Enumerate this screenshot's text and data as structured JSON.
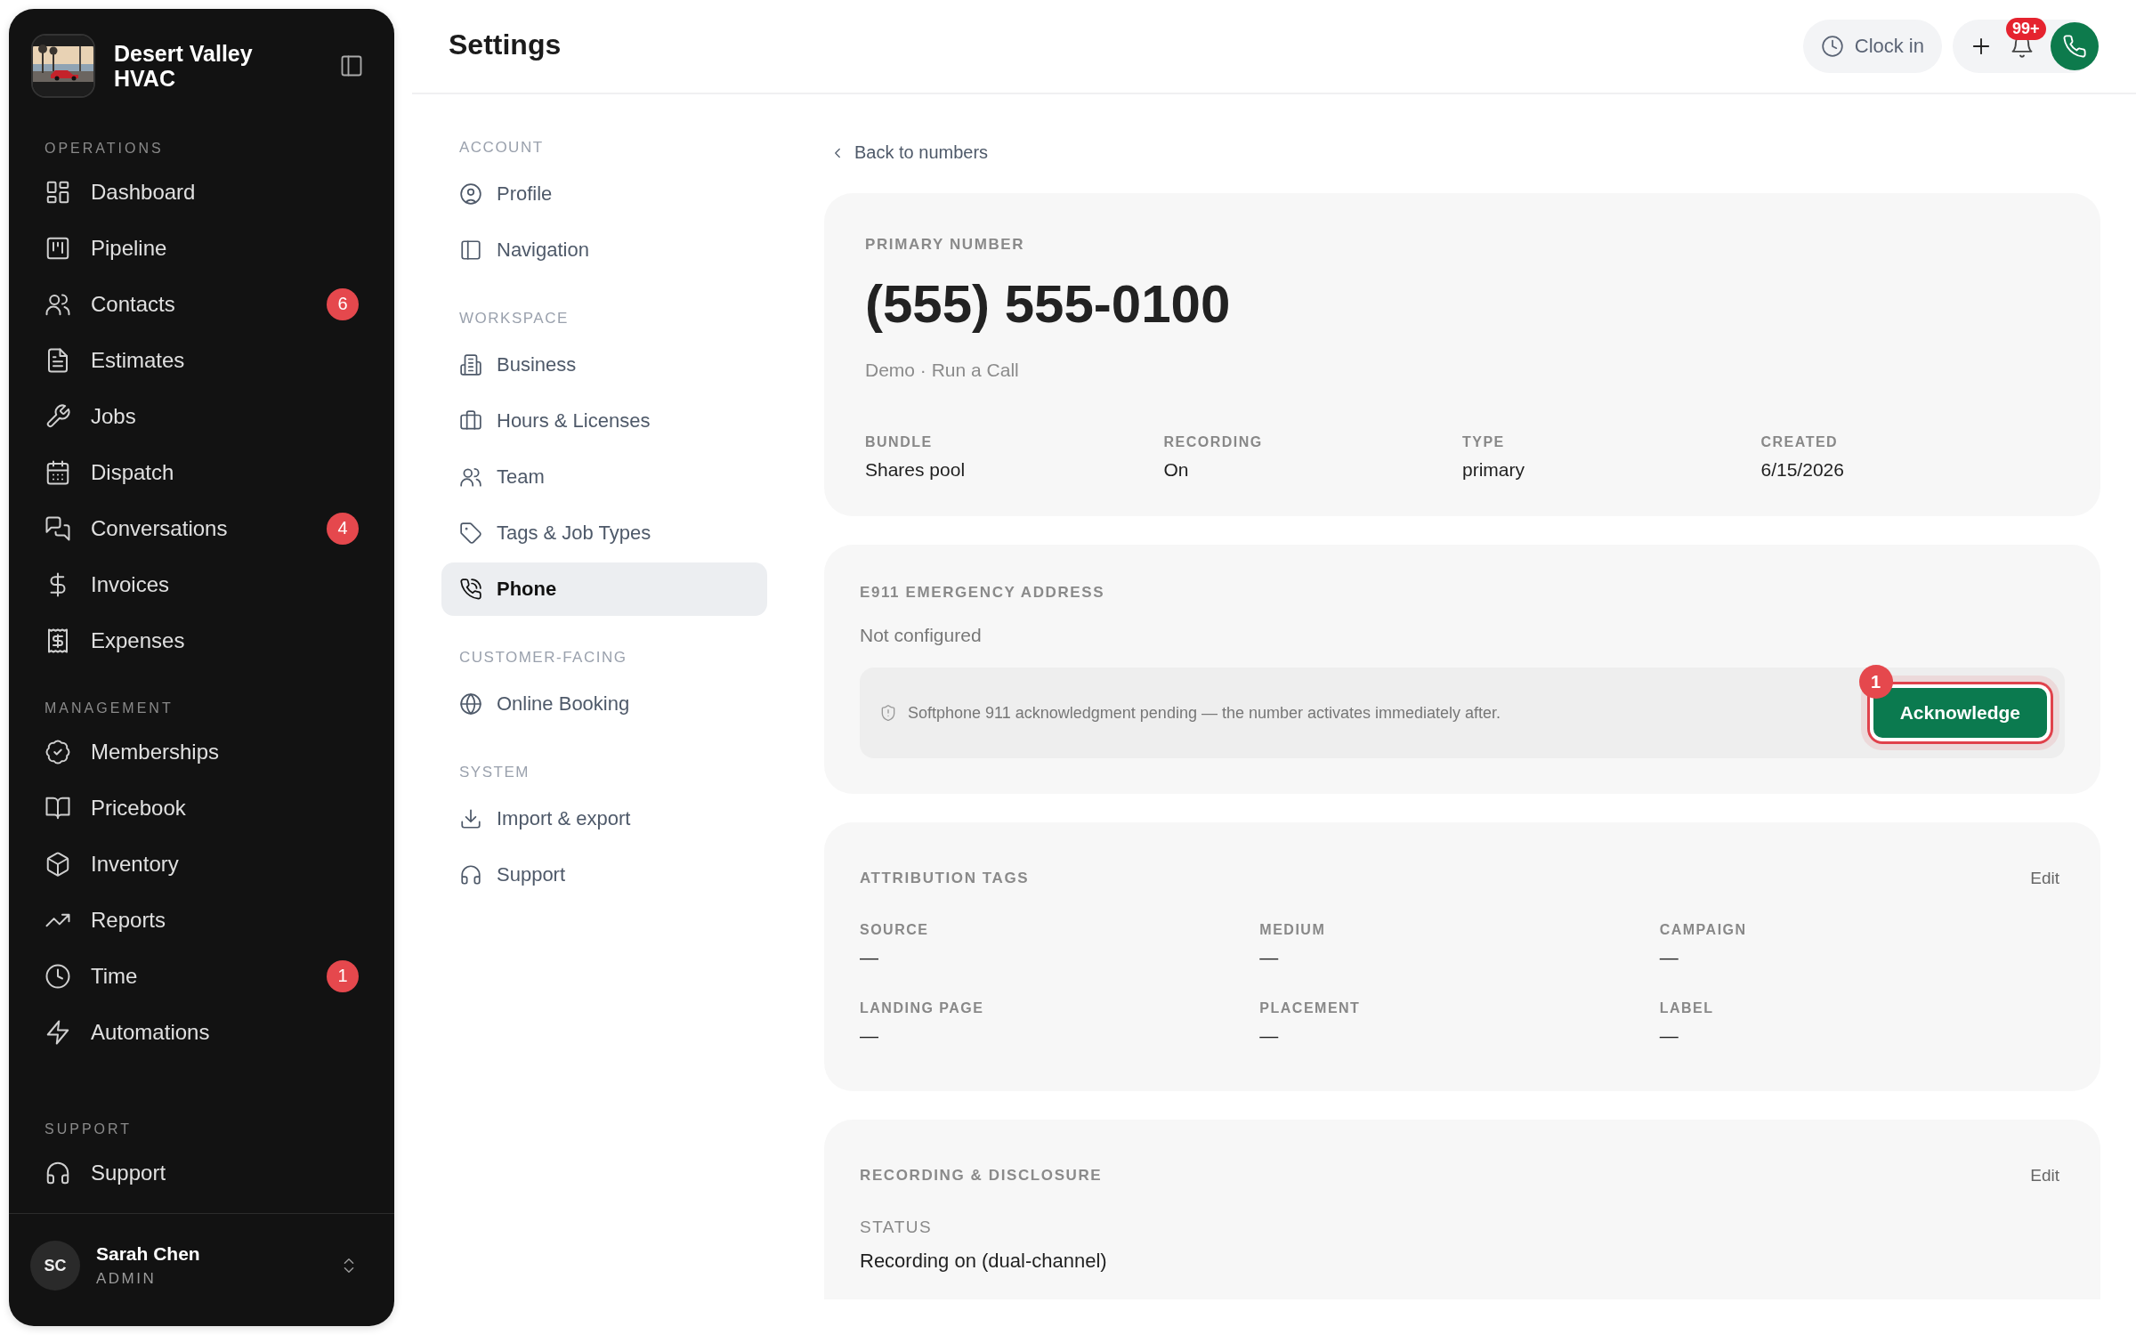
{
  "brand": {
    "name": "Desert Valley HVAC"
  },
  "sidebar": {
    "sections": [
      {
        "label": "OPERATIONS",
        "items": [
          {
            "label": "Dashboard",
            "selected": false
          },
          {
            "label": "Pipeline",
            "selected": false
          },
          {
            "label": "Contacts",
            "badge": "6",
            "selected": false
          },
          {
            "label": "Estimates",
            "selected": false
          },
          {
            "label": "Jobs",
            "selected": false
          },
          {
            "label": "Dispatch",
            "selected": false
          },
          {
            "label": "Conversations",
            "badge": "4",
            "selected": false
          },
          {
            "label": "Invoices",
            "selected": false
          },
          {
            "label": "Expenses",
            "selected": false
          }
        ]
      },
      {
        "label": "MANAGEMENT",
        "items": [
          {
            "label": "Memberships",
            "selected": false
          },
          {
            "label": "Pricebook",
            "selected": false
          },
          {
            "label": "Inventory",
            "selected": false
          },
          {
            "label": "Reports",
            "selected": false
          },
          {
            "label": "Time",
            "badge": "1",
            "selected": false
          },
          {
            "label": "Automations",
            "selected": false
          }
        ]
      }
    ],
    "support": {
      "label": "SUPPORT",
      "items": [
        {
          "label": "Support",
          "selected": false
        }
      ]
    }
  },
  "user": {
    "initials": "SC",
    "name": "Sarah Chen",
    "role": "ADMIN"
  },
  "page_title": "Settings",
  "header": {
    "clock_in": "Clock in",
    "notifications_badge": "99+"
  },
  "settings_nav": {
    "sections": [
      {
        "label": "ACCOUNT",
        "items": [
          {
            "label": "Profile",
            "selected": false
          },
          {
            "label": "Navigation",
            "selected": false
          }
        ]
      },
      {
        "label": "WORKSPACE",
        "items": [
          {
            "label": "Business",
            "selected": false
          },
          {
            "label": "Hours & Licenses",
            "selected": false
          },
          {
            "label": "Team",
            "selected": false
          },
          {
            "label": "Tags & Job Types",
            "selected": false
          },
          {
            "label": "Phone",
            "selected": true
          }
        ]
      },
      {
        "label": "CUSTOMER-FACING",
        "items": [
          {
            "label": "Online Booking",
            "selected": false
          }
        ]
      },
      {
        "label": "SYSTEM",
        "items": [
          {
            "label": "Import & export",
            "selected": false
          },
          {
            "label": "Support",
            "selected": false
          }
        ]
      }
    ]
  },
  "back_link": "Back to numbers",
  "primary_card": {
    "label": "PRIMARY NUMBER",
    "number": "(555) 555-0100",
    "subtitle": "Demo · Run a Call",
    "fields": [
      {
        "label": "BUNDLE",
        "value": "Shares pool"
      },
      {
        "label": "RECORDING",
        "value": "On"
      },
      {
        "label": "TYPE",
        "value": "primary"
      },
      {
        "label": "CREATED",
        "value": "6/15/2026"
      }
    ]
  },
  "e911_card": {
    "label": "E911 EMERGENCY ADDRESS",
    "status": "Not configured",
    "notice": "Softphone 911 acknowledgment pending — the number activates immediately after.",
    "button": "Acknowledge",
    "step_badge": "1"
  },
  "attribution_card": {
    "label": "ATTRIBUTION TAGS",
    "edit": "Edit",
    "fields": [
      {
        "label": "SOURCE",
        "value": "—"
      },
      {
        "label": "MEDIUM",
        "value": "—"
      },
      {
        "label": "CAMPAIGN",
        "value": "—"
      },
      {
        "label": "LANDING PAGE",
        "value": "—"
      },
      {
        "label": "PLACEMENT",
        "value": "—"
      },
      {
        "label": "LABEL",
        "value": "—"
      }
    ]
  },
  "recording_card": {
    "label": "RECORDING & DISCLOSURE",
    "edit": "Edit",
    "fields": [
      {
        "label": "STATUS",
        "value": "Recording on (dual-channel)"
      }
    ]
  }
}
